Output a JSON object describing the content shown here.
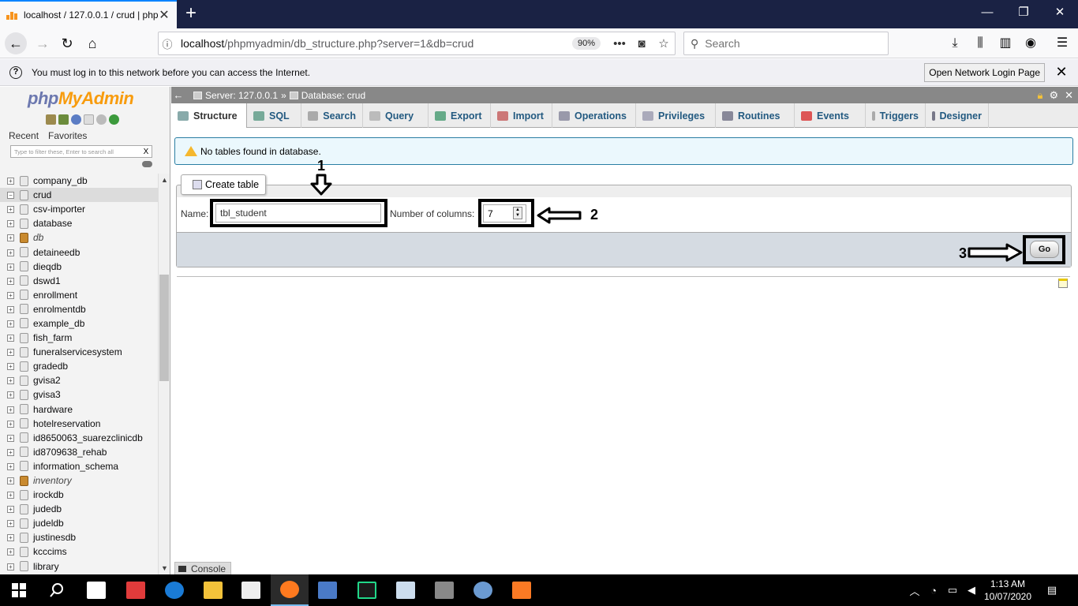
{
  "browser": {
    "tab_title": "localhost / 127.0.0.1 / crud | php",
    "tab_close": "✕",
    "new_tab": "+",
    "url_host": "localhost",
    "url_path": "/phpmyadmin/db_structure.php?server=1&db=crud",
    "zoom": "90%",
    "search_placeholder": "Search",
    "page_actions": "•••"
  },
  "notification": {
    "message": "You must log in to this network before you can access the Internet.",
    "button": "Open Network Login Page",
    "close": "✕"
  },
  "pma_nav": {
    "logo_php": "php",
    "logo_my": "MyAdmin",
    "tabs": [
      "Recent",
      "Favorites"
    ],
    "filter_placeholder": "Type to filter these, Enter to search all",
    "filter_clear": "X",
    "databases": [
      {
        "name": "company_db"
      },
      {
        "name": "crud"
      },
      {
        "name": "csv-importer"
      },
      {
        "name": "database"
      },
      {
        "name": "db"
      },
      {
        "name": "detaineedb"
      },
      {
        "name": "dieqdb"
      },
      {
        "name": "dswd1"
      },
      {
        "name": "enrollment"
      },
      {
        "name": "enrolmentdb"
      },
      {
        "name": "example_db"
      },
      {
        "name": "fish_farm"
      },
      {
        "name": "funeralservicesystem"
      },
      {
        "name": "gradedb"
      },
      {
        "name": "gvisa2"
      },
      {
        "name": "gvisa3"
      },
      {
        "name": "hardware"
      },
      {
        "name": "hotelreservation"
      },
      {
        "name": "id8650063_suarezclinicdb"
      },
      {
        "name": "id8709638_rehab"
      },
      {
        "name": "information_schema"
      },
      {
        "name": "inventory"
      },
      {
        "name": "irockdb"
      },
      {
        "name": "judedb"
      },
      {
        "name": "judeldb"
      },
      {
        "name": "justinesdb"
      },
      {
        "name": "kcccims"
      },
      {
        "name": "library"
      }
    ]
  },
  "breadcrumb": {
    "server": "Server: 127.0.0.1",
    "sep": "»",
    "database": "Database: crud"
  },
  "menu_tabs": [
    "Structure",
    "SQL",
    "Search",
    "Query",
    "Export",
    "Import",
    "Operations",
    "Privileges",
    "Routines",
    "Events",
    "Triggers",
    "Designer"
  ],
  "notice": "No tables found in database.",
  "create_table": {
    "legend": "Create table",
    "name_label": "Name:",
    "name_value": "tbl_student",
    "columns_label": "Number of columns:",
    "columns_value": "7",
    "go": "Go"
  },
  "annotations": {
    "one": "1",
    "two": "2",
    "three": "3"
  },
  "console": "Console",
  "taskbar": {
    "time": "1:13 AM",
    "date": "10/07/2020"
  },
  "colors": {
    "accent": "#0a84ff",
    "titlebar": "#1a2244",
    "pma_link": "#235a81"
  }
}
